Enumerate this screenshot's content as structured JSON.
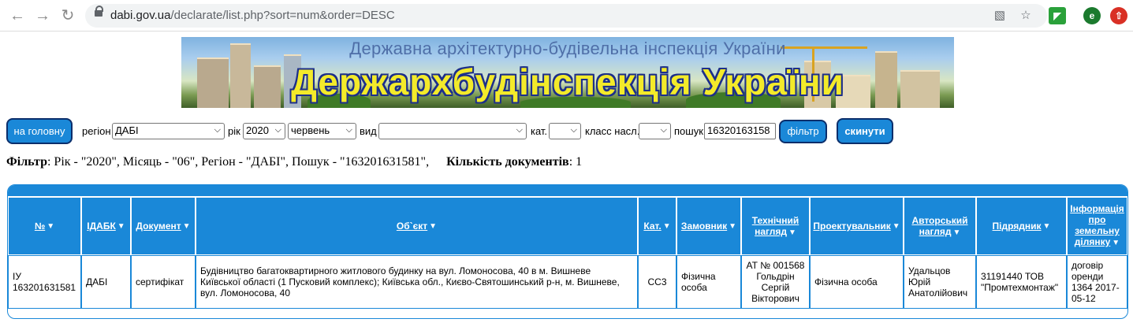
{
  "browser": {
    "url_host": "dabi.gov.ua",
    "url_path": "/declarate/list.php?sort=num&order=DESC",
    "profile_initial": "e"
  },
  "banner": {
    "subtitle": "Державна архітектурно-будівельна інспекція України",
    "title": "Держархбудінспекція України"
  },
  "filters": {
    "home_button": "на головну",
    "region_label": "регіон",
    "region_value": "ДАБІ",
    "year_label": "рік",
    "year_value": "2020",
    "month_value": "червень",
    "type_label": "вид",
    "type_value": "",
    "cat_label": "кат.",
    "cat_value": "",
    "class_label": "класс насл.",
    "class_value": "",
    "search_label": "пошук",
    "search_value": "16320163158",
    "filter_button": "фільтр",
    "reset_button": "скинути"
  },
  "summary": {
    "filter_label": "Фільтр",
    "filter_text": ": Рік - \"2020\", Місяць - \"06\", Регіон - \"ДАБІ\", Пошук - \"163201631581\",",
    "count_label": "Кількість документів",
    "count_value": ": 1"
  },
  "table": {
    "headers": {
      "num": "№",
      "idabk": "ІДАБК",
      "doc": "Документ",
      "object": "Об`єкт",
      "cat": "Кат.",
      "customer": "Замовник",
      "tech1": "Технічний",
      "tech2": "нагляд",
      "designer": "Проектувальник",
      "author1": "Авторський",
      "author2": "нагляд",
      "contractor": "Підрядник",
      "land1": "Інформація",
      "land2": "про",
      "land3": "земельну",
      "land4": "ділянку"
    },
    "row": {
      "num1": "ІУ",
      "num2": "163201631581",
      "idabk": "ДАБІ",
      "doc": "сертифікат",
      "object1": "Будівництво багатоквартирного житлового будинку на вул. Ломоносова, 40 в м. Вишневе",
      "object2": "Київської області (1 Пусковий комплекс); Київська обл., Києво-Святошинський р-н, м. Вишневе,",
      "object3": "вул. Ломоносова, 40",
      "cat": "СС3",
      "customer1": "Фізична",
      "customer2": "особа",
      "tech1": "АТ № 001568",
      "tech2": "Гольдрін",
      "tech3": "Сергій",
      "tech4": "Вікторович",
      "designer": "Фізична особа",
      "author1": "Удальцов",
      "author2": "Юрій",
      "author3": "Анатолійович",
      "contractor1": "31191440 ТОВ",
      "contractor2": "\"Промтехмонтаж\"",
      "land1": "договір",
      "land2": "оренди",
      "land3": "1364 2017-",
      "land4": "05-12"
    }
  },
  "colors": {
    "accent": "#1a88d8",
    "button_border": "#0b2e6b",
    "banner_title": "#f3ea2a",
    "banner_title_outline": "#1d2f8a"
  },
  "icons": {
    "back": "arrow-left-icon",
    "forward": "arrow-right-icon",
    "reload": "reload-icon",
    "lock": "lock-icon",
    "translate": "translate-icon",
    "star": "star-icon",
    "sort": "triangle-down-icon"
  }
}
